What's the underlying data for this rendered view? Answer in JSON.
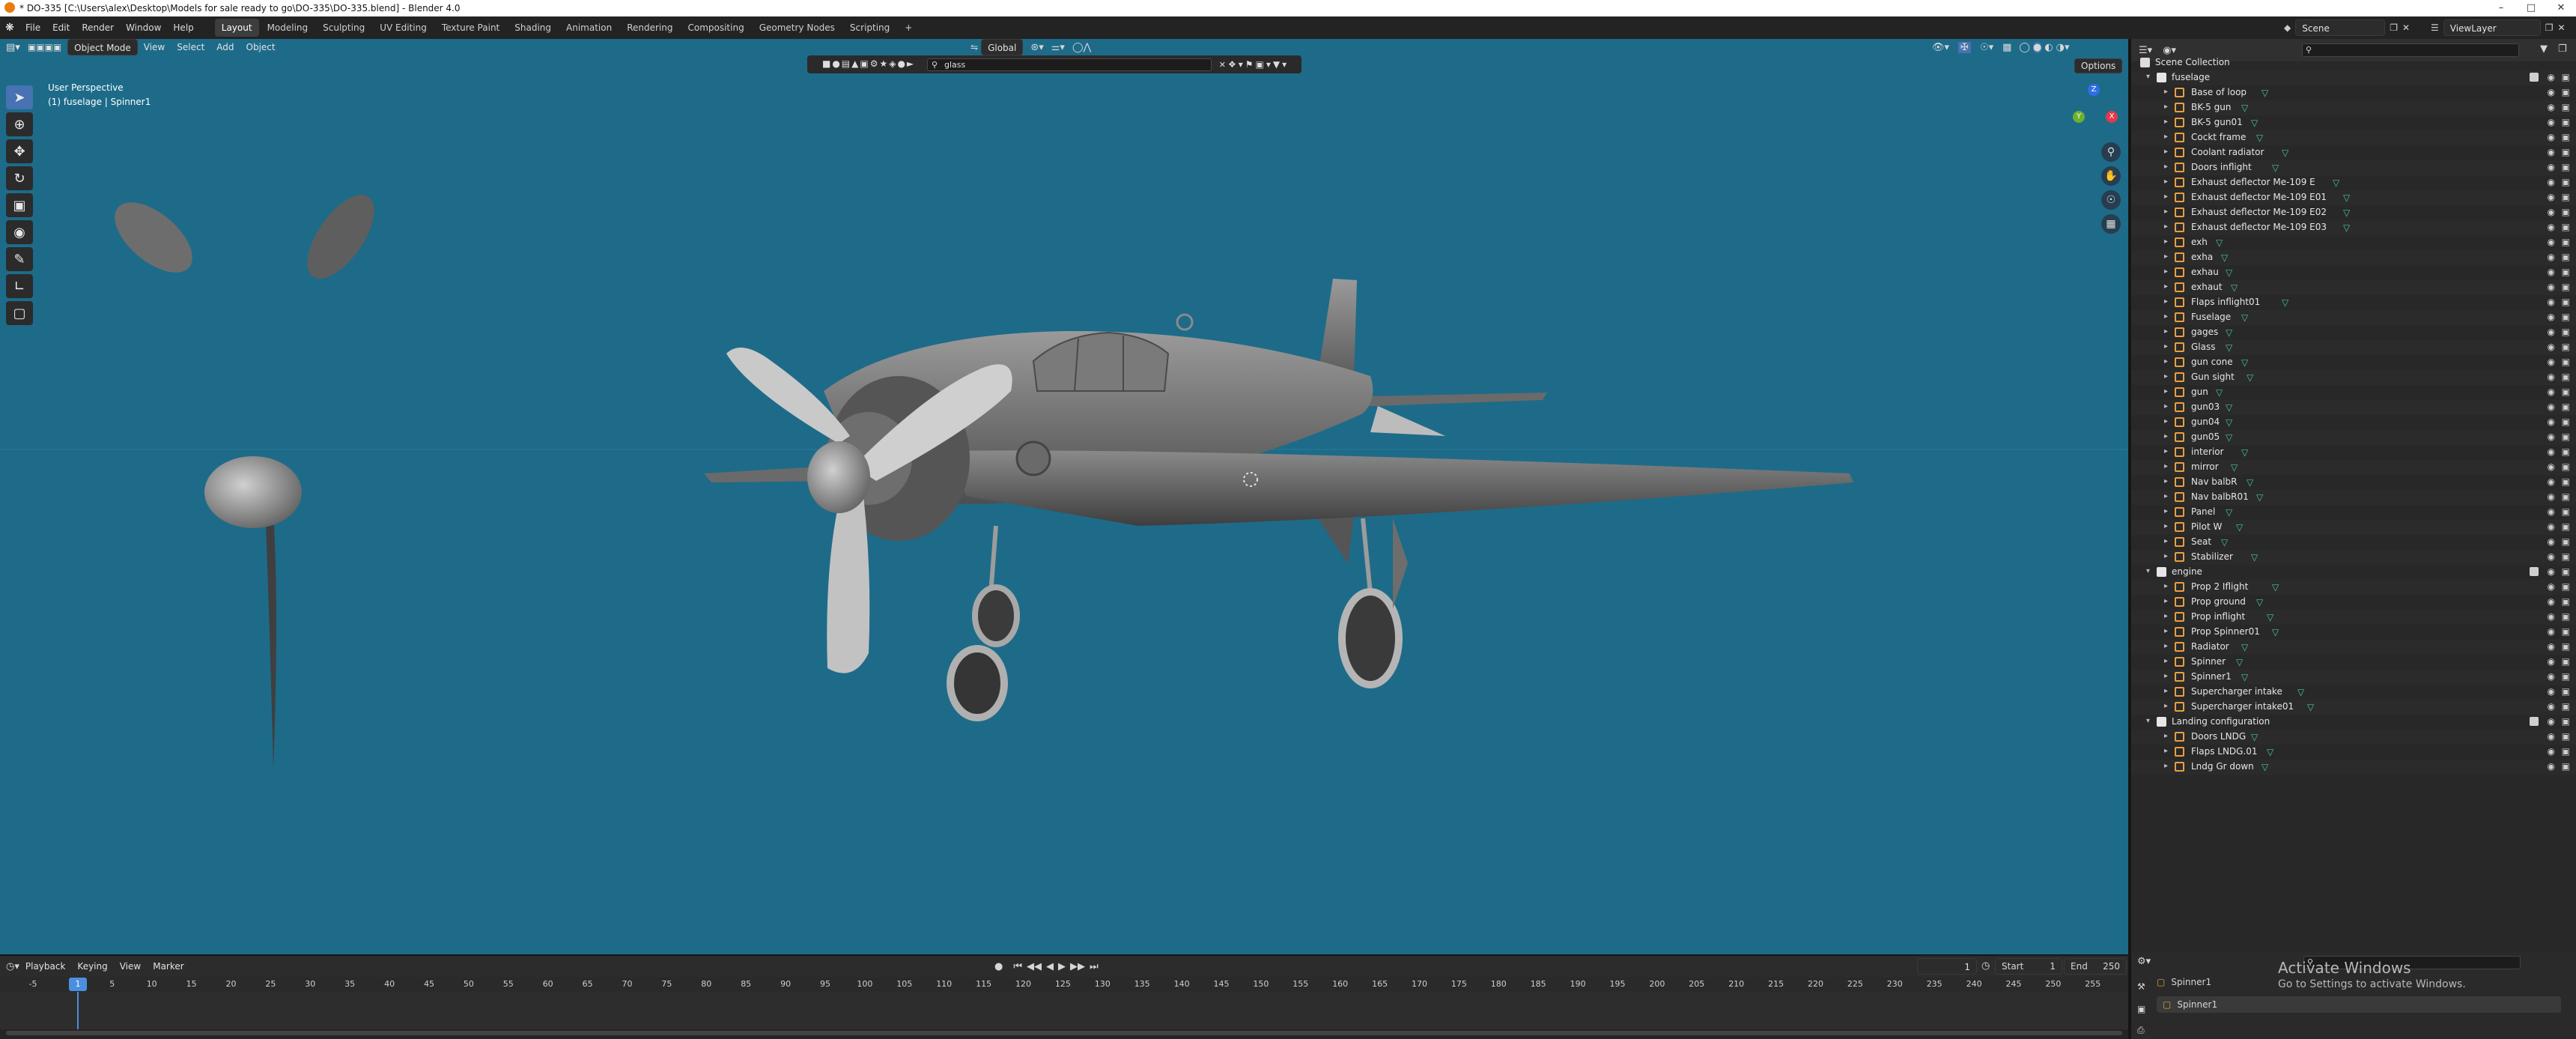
{
  "titlebar": {
    "title": "* DO-335 [C:\\Users\\alex\\Desktop\\Models for sale ready to go\\DO-335\\DO-335.blend] - Blender 4.0"
  },
  "menu": {
    "items": [
      "File",
      "Edit",
      "Render",
      "Window",
      "Help"
    ],
    "workspaces": [
      "Layout",
      "Modeling",
      "Sculpting",
      "UV Editing",
      "Texture Paint",
      "Shading",
      "Animation",
      "Rendering",
      "Compositing",
      "Geometry Nodes",
      "Scripting"
    ],
    "active_workspace": "Layout",
    "add_tab": "+",
    "scene": "Scene",
    "view_layer": "ViewLayer"
  },
  "viewport_header": {
    "mode": "Object Mode",
    "menus": [
      "View",
      "Select",
      "Add",
      "Object"
    ],
    "orientation": "Global",
    "options": "Options",
    "search_value": "glass"
  },
  "viewport": {
    "perspective": "User Perspective",
    "context": "(1) fuselage | Spinner1",
    "gizmo": {
      "y": "Y",
      "x": "X",
      "z": "Z"
    },
    "bg_color": "#1d6b89"
  },
  "outliner": {
    "search_placeholder": "",
    "root": "Scene Collection",
    "collections": [
      {
        "name": "fuselage",
        "objects": [
          "Base of loop",
          "BK-5 gun",
          "BK-5 gun01",
          "Cockt frame",
          "Coolant radiator",
          "Doors inflight",
          "Exhaust deflector Me-109 E",
          "Exhaust deflector Me-109 E01",
          "Exhaust deflector Me-109 E02",
          "Exhaust deflector Me-109 E03",
          "exh",
          "exha",
          "exhau",
          "exhaut",
          "Flaps inflight01",
          "Fuselage",
          "gages",
          "Glass",
          "gun cone",
          "Gun sight",
          "gun",
          "gun03",
          "gun04",
          "gun05",
          "interior",
          "mirror",
          "Nav balbR",
          "Nav balbR01",
          "Panel",
          "Pilot W",
          "Seat",
          "Stabilizer"
        ]
      },
      {
        "name": "engine",
        "objects": [
          "Prop 2 Iflight",
          "Prop ground",
          "Prop inflight",
          "Prop Spinner01",
          "Radiator",
          "Spinner",
          "Spinner1",
          "Supercharger intake",
          "Supercharger intake01"
        ]
      },
      {
        "name": "Landing configuration",
        "objects": [
          "Doors LNDG",
          "Flaps LNDG.01",
          "Lndg Gr down"
        ]
      }
    ]
  },
  "timeline": {
    "menus": [
      "Playback",
      "Keying",
      "View",
      "Marker"
    ],
    "current_frame": "1",
    "start_label": "Start",
    "start": "1",
    "end_label": "End",
    "end": "250",
    "ruler_ticks": [
      "-5",
      "0",
      "5",
      "10",
      "15",
      "20",
      "25",
      "30",
      "35",
      "40",
      "45",
      "50",
      "55",
      "60",
      "65",
      "70",
      "75",
      "80",
      "85",
      "90",
      "95",
      "100",
      "105",
      "110",
      "115",
      "120",
      "125",
      "130",
      "135",
      "140",
      "145",
      "150",
      "155",
      "160",
      "165",
      "170",
      "175",
      "180",
      "185",
      "190",
      "195",
      "200",
      "205",
      "210",
      "215",
      "220",
      "225",
      "230",
      "235",
      "240",
      "245",
      "250",
      "255"
    ],
    "playhead": "1"
  },
  "properties": {
    "object_name": "Spinner1",
    "object_name2": "Spinner1",
    "activate_title": "Activate Windows",
    "activate_sub": "Go to Settings to activate Windows."
  }
}
